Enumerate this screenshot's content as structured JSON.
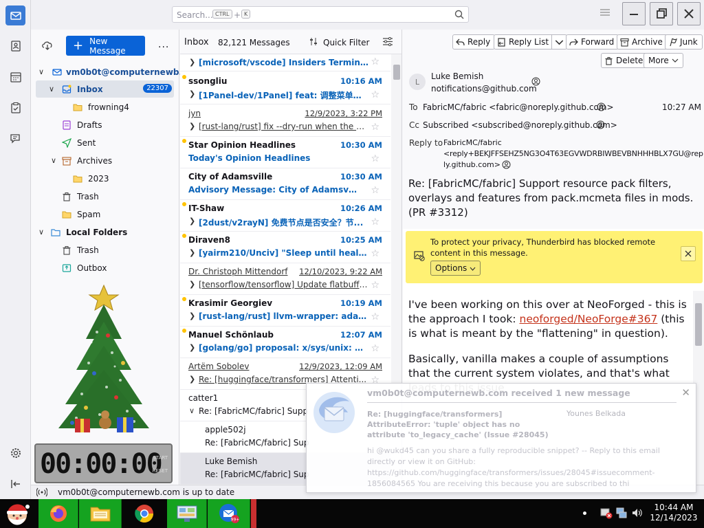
{
  "titlebar": {
    "search_placeholder": "Search...",
    "kbd_ctrl": "CTRL",
    "kbd_plus": "+",
    "kbd_k": "K"
  },
  "folder_pane": {
    "new_message": "New Message",
    "more": "...",
    "account": "vm0b0t@computernewb.com",
    "folders": [
      {
        "label": "Inbox",
        "count": "22307"
      },
      {
        "label": "frowning4"
      },
      {
        "label": "Drafts"
      },
      {
        "label": "Sent"
      },
      {
        "label": "Archives"
      },
      {
        "label": "2023"
      },
      {
        "label": "Trash"
      },
      {
        "label": "Spam"
      },
      {
        "label": "Local Folders"
      },
      {
        "label": "Trash"
      },
      {
        "label": "Outbox"
      }
    ],
    "clock": "00:00:00",
    "clock_start": "START",
    "clock_reset": "RESET"
  },
  "message_list": {
    "folder": "Inbox",
    "count": "82,121 Messages",
    "quick_filter": "Quick Filter",
    "rows": [
      {
        "sender": "",
        "date": "",
        "subject": "[microsoft/vscode] Insiders Terminal ..."
      },
      {
        "sender": "ssongliu",
        "date": "10:16 AM",
        "subject": "[1Panel-dev/1Panel] feat: 调整菜单次..."
      },
      {
        "sender": "jyn",
        "date": "12/9/2023, 3:22 PM",
        "subject": "[rust-lang/rust] fix --dry-run when the ch..."
      },
      {
        "sender": "Star Opinion Headlines",
        "date": "10:30 AM",
        "subject": "Today's Opinion Headlines"
      },
      {
        "sender": "City of Adamsville",
        "date": "10:30 AM",
        "subject": "Advisory Message: City of Adamsville"
      },
      {
        "sender": "IT-Shaw",
        "date": "10:26 AM",
        "subject": "[2dust/v2rayN] 免费节点是否安全？节..."
      },
      {
        "sender": "Diraven8",
        "date": "10:25 AM",
        "subject": "[yairm210/Unciv] \"Sleep until healed..."
      },
      {
        "sender": "Dr. Christoph Mittendorf",
        "date": "12/10/2023, 9:22 AM",
        "subject": "[tensorflow/tensorflow] Update flatbuffe..."
      },
      {
        "sender": "Krasimir Georgiev",
        "date": "10:19 AM",
        "subject": "[rust-lang/rust] llvm-wrapper: adapt ..."
      },
      {
        "sender": "Manuel Schönlaub",
        "date": "12:07 AM",
        "subject": "[golang/go] proposal: x/sys/unix: ad..."
      },
      {
        "sender": "Artëm Sobolev",
        "date": "12/9/2023, 12:09 AM",
        "subject": "Re: [huggingface/transformers] Attenti..."
      },
      {
        "sender": "catter1",
        "date": "",
        "subject": "Re: [FabricMC/fabric] Supp"
      },
      {
        "sender": "apple502j",
        "date": "",
        "subject": "Re: [FabricMC/fabric] Sup"
      },
      {
        "sender": "Luke Bemish",
        "date": "",
        "subject": "Re: [FabricMC/fabric] Sup"
      }
    ]
  },
  "reader": {
    "toolbar": {
      "reply": "Reply",
      "reply_list": "Reply List",
      "forward": "Forward",
      "archive": "Archive",
      "junk": "Junk",
      "delete": "Delete",
      "more": "More"
    },
    "avatar_letter": "L",
    "from_name": "Luke Bemish",
    "from_email": "notifications@github.com",
    "to_label": "To",
    "to_value": "FabricMC/fabric <fabric@noreply.github.com>",
    "time": "10:27 AM",
    "cc_label": "Cc",
    "cc_value": "Subscribed <subscribed@noreply.github.com>",
    "replyto_label": "Reply to",
    "replyto_line1": "FabricMC/fabric",
    "replyto_line2": "<reply+BEKJFFSEHZ5NG3O4T63EGVWDRBIWBEVBNHHHBLX7GU@rep",
    "replyto_line3": "ly.github.com>",
    "subject": "Re: [FabricMC/fabric] Support resource pack filters, overlays and features from pack.mcmeta files in mods. (PR #3312)",
    "privacy_msg": "To protect your privacy, Thunderbird has blocked remote content in this message.",
    "options": "Options",
    "body_p1_a": "I've been working on this over at NeoForged - this is the approach I took: ",
    "body_p1_link": "neoforged/NeoForge#367",
    "body_p1_b": " (this is what is meant by the \"flattening\" in question).",
    "body_p2": "Basically, vanilla makes a couple of assumptions that the current system violates, and that's what leads to this issue"
  },
  "notification": {
    "title": "vm0b0t@computernewb.com received 1 new message",
    "subject": "Re: [huggingface/transformers] AttributeError: 'tuple' object has no attribute 'to_legacy_cache' (Issue #28045)",
    "from": "Younes Belkada",
    "preview": "hi @wukd45 can you share a fully reproducible snippet? -- Reply to this email directly or view it on GitHub: https://github.com/huggingface/transformers/issues/28045#issuecomment-1856084565 You are receiving this because you are subscribed to thi"
  },
  "status": {
    "text": "vm0b0t@computernewb.com is up to date"
  },
  "taskbar": {
    "time": "10:44 AM",
    "date": "12/14/2023"
  }
}
